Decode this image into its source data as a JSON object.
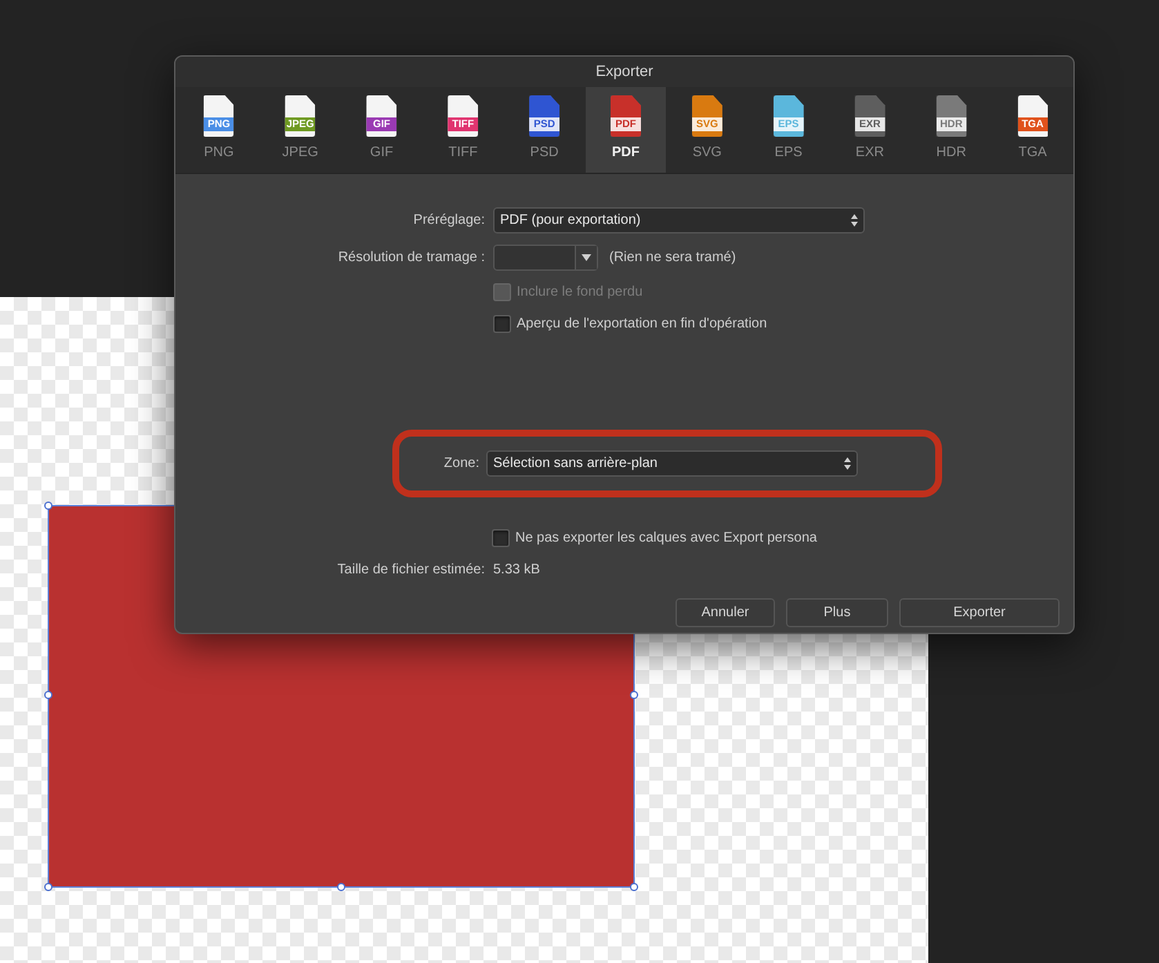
{
  "window": {
    "title": "Exporter"
  },
  "formats": [
    {
      "badge": "PNG",
      "label": "PNG",
      "kind": "band",
      "color": "#4a8ee6",
      "selected": false
    },
    {
      "badge": "JPEG",
      "label": "JPEG",
      "kind": "band",
      "color": "#6f9a22",
      "selected": false
    },
    {
      "badge": "GIF",
      "label": "GIF",
      "kind": "band",
      "color": "#9a3ab3",
      "selected": false
    },
    {
      "badge": "TIFF",
      "label": "TIFF",
      "kind": "band",
      "color": "#e0346f",
      "selected": false
    },
    {
      "badge": "PSD",
      "label": "PSD",
      "kind": "filled",
      "color": "#2f55d2",
      "selected": false
    },
    {
      "badge": "PDF",
      "label": "PDF",
      "kind": "filled",
      "color": "#c8302a",
      "selected": true
    },
    {
      "badge": "SVG",
      "label": "SVG",
      "kind": "filled",
      "color": "#d97a10",
      "selected": false
    },
    {
      "badge": "EPS",
      "label": "EPS",
      "kind": "filled",
      "color": "#5bb7dc",
      "selected": false
    },
    {
      "badge": "EXR",
      "label": "EXR",
      "kind": "filled",
      "color": "#5e5e5e",
      "selected": false
    },
    {
      "badge": "HDR",
      "label": "HDR",
      "kind": "filled",
      "color": "#7a7a7a",
      "selected": false
    },
    {
      "badge": "TGA",
      "label": "TGA",
      "kind": "band",
      "color": "#e0521c",
      "selected": false
    }
  ],
  "preset": {
    "label": "Préréglage:",
    "value": "PDF (pour exportation)"
  },
  "raster": {
    "label": "Résolution de tramage :",
    "hint": "(Rien ne sera tramé)"
  },
  "options": [
    {
      "label": "Inclure le fond perdu",
      "checked": false,
      "disabled": true
    },
    {
      "label": "Aperçu de l'exportation en fin d'opération",
      "checked": false,
      "disabled": false
    }
  ],
  "zone": {
    "label": "Zone:",
    "value": "Sélection sans arrière-plan",
    "highlighted": true
  },
  "layers_option": {
    "label": "Ne pas exporter les calques avec Export persona",
    "checked": false,
    "disabled": false
  },
  "file_size": {
    "label": "Taille de fichier estimée:",
    "value": "5.33 kB"
  },
  "buttons": [
    "Annuler",
    "Plus",
    "Exporter"
  ]
}
